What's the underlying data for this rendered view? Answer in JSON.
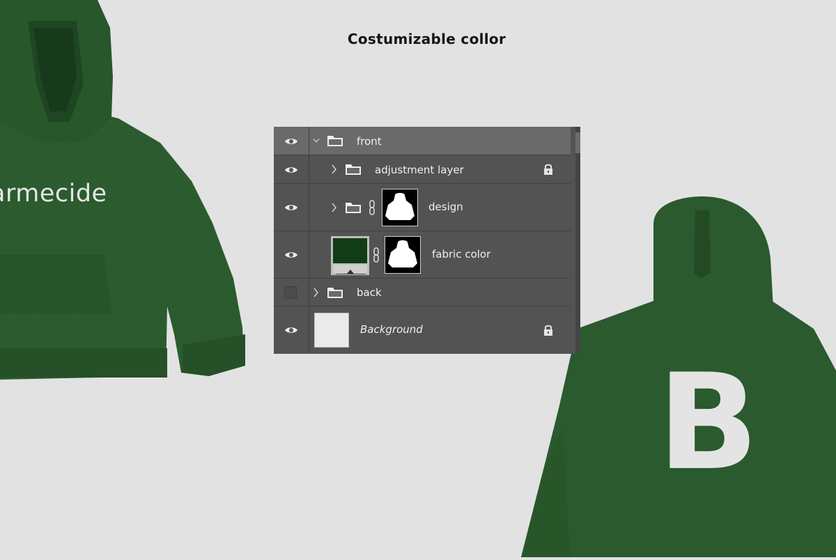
{
  "heading": "Costumizable collor",
  "mockup": {
    "front_print": "armecide",
    "back_print": "B",
    "fabric_color": "#2a5a2e"
  },
  "layers_panel": {
    "layers": [
      {
        "name": "front",
        "visible": true,
        "type": "group",
        "expanded": true,
        "selected": true
      },
      {
        "name": "adjustment layer",
        "visible": true,
        "type": "group",
        "expanded": false,
        "locked": true
      },
      {
        "name": "design",
        "visible": true,
        "type": "group-with-mask",
        "expanded": false
      },
      {
        "name": "fabric color",
        "visible": true,
        "type": "fill-with-mask",
        "color": "#123c16"
      },
      {
        "name": "back",
        "visible": false,
        "type": "group",
        "expanded": false
      },
      {
        "name": "Background",
        "visible": true,
        "type": "background",
        "locked": true
      }
    ]
  }
}
